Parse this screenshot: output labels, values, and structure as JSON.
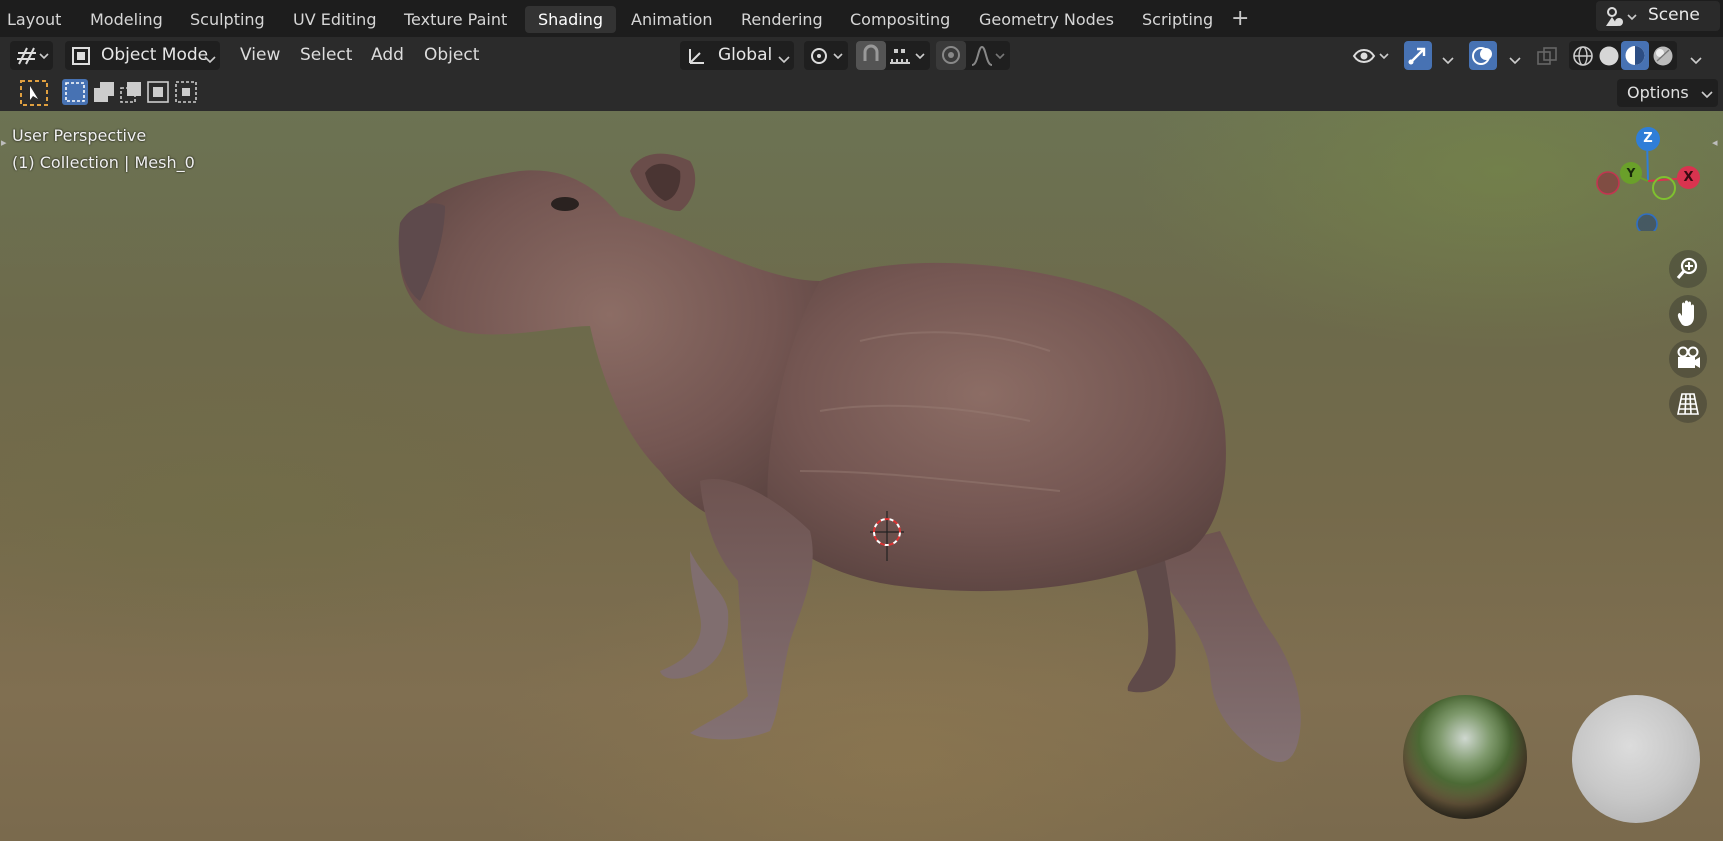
{
  "workspace_tabs": [
    "Layout",
    "Modeling",
    "Sculpting",
    "UV Editing",
    "Texture Paint",
    "Shading",
    "Animation",
    "Rendering",
    "Compositing",
    "Geometry Nodes",
    "Scripting"
  ],
  "active_tab": "Shading",
  "add_workspace": "+",
  "scene": {
    "label": "Scene",
    "icon": "scene-icon"
  },
  "header": {
    "mode": "Object Mode",
    "menus": [
      "View",
      "Select",
      "Add",
      "Object"
    ],
    "orientation": "Global",
    "icons": [
      "editor-type-icon",
      "object-mode-icon",
      "transform-orientation-icon",
      "pivot-icon",
      "snap-icon",
      "snap-increment-icon",
      "proportional-edit-icon",
      "falloff-icon",
      "visibility-icon",
      "gizmo-icon",
      "overlay-icon",
      "xray-icon",
      "wireframe-shading-icon",
      "solid-shading-icon",
      "material-preview-icon",
      "rendered-shading-icon"
    ]
  },
  "toolbar": {
    "options": "Options"
  },
  "viewport": {
    "title": "User Perspective",
    "collection": "(1) Collection | Mesh_0",
    "gizmo_axes": {
      "x": "X",
      "y": "Y",
      "z": "Z"
    },
    "nav_icons": [
      "zoom-icon",
      "hand-pan-icon",
      "camera-icon",
      "grid-ortho-icon"
    ],
    "accent": {
      "x_axis": "#d9334f",
      "y_axis": "#6aa02a",
      "z_axis": "#2f7ed8",
      "active_blue": "#4772b3"
    }
  }
}
